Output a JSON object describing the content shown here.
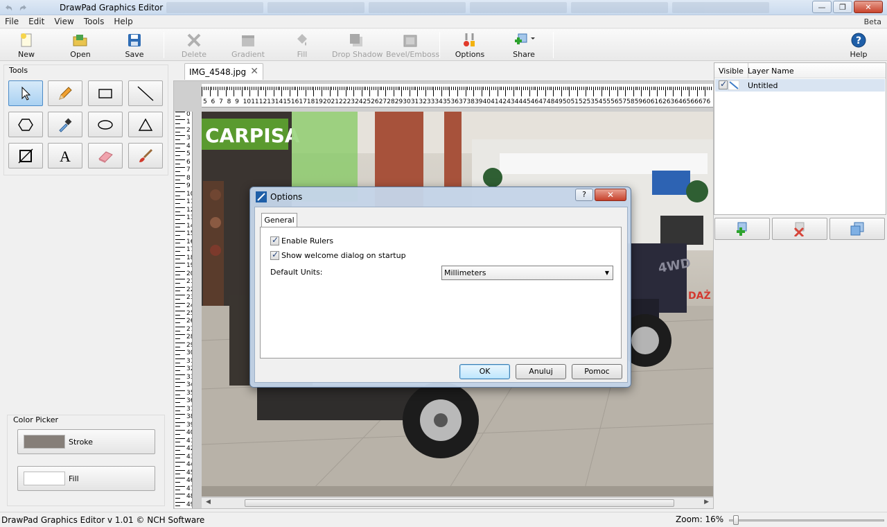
{
  "window": {
    "title": "DrawPad Graphics Editor",
    "min": "—",
    "max": "❐",
    "close": "✕"
  },
  "menu": {
    "items": [
      "File",
      "Edit",
      "View",
      "Tools",
      "Help"
    ],
    "beta": "Beta"
  },
  "toolbar": {
    "new": "New",
    "open": "Open",
    "save": "Save",
    "delete": "Delete",
    "gradient": "Gradient",
    "fill": "Fill",
    "drop_shadow": "Drop Shadow",
    "bevel_emboss": "Bevel/Emboss",
    "options": "Options",
    "share": "Share",
    "help": "Help"
  },
  "tools": {
    "label": "Tools"
  },
  "color_picker": {
    "label": "Color Picker",
    "stroke_label": "Stroke",
    "stroke_color": "#867f79",
    "fill_label": "Fill",
    "fill_color": "#ffffff"
  },
  "document": {
    "tab_name": "IMG_4548.jpg",
    "tab_close": "✕"
  },
  "rulers": {
    "horizontal": [
      "5",
      "6",
      "7",
      "8",
      "9",
      "10",
      "11",
      "12",
      "13",
      "14",
      "15",
      "16",
      "17",
      "18",
      "19",
      "20",
      "21",
      "22",
      "23",
      "24",
      "25",
      "26",
      "27",
      "28",
      "29",
      "30",
      "31",
      "32",
      "33",
      "34",
      "35",
      "36",
      "37",
      "38",
      "39",
      "40",
      "41",
      "42",
      "43",
      "44",
      "45",
      "46",
      "47",
      "48",
      "49",
      "50",
      "51",
      "52",
      "53",
      "54",
      "55",
      "56",
      "57",
      "58",
      "59",
      "60",
      "61",
      "62",
      "63",
      "64",
      "65",
      "66",
      "67",
      "6"
    ],
    "vertical": [
      "0",
      "1",
      "2",
      "3",
      "4",
      "5",
      "6",
      "7",
      "8",
      "9",
      "10",
      "11",
      "12",
      "13",
      "14",
      "15",
      "16",
      "17",
      "18",
      "19",
      "20",
      "21",
      "22",
      "23",
      "24",
      "25",
      "26",
      "27",
      "28",
      "29",
      "30",
      "31",
      "32",
      "33",
      "34",
      "35",
      "36",
      "37",
      "38",
      "39",
      "40",
      "41",
      "42",
      "43",
      "44",
      "45",
      "46",
      "47",
      "48",
      "49"
    ]
  },
  "photo": {
    "shop_sign": "CARPISA",
    "sale_text": "DAŻ"
  },
  "layers": {
    "col_visible": "Visible",
    "col_name": "Layer Name",
    "rows": [
      {
        "name": "Untitled"
      }
    ]
  },
  "status": {
    "text": "DrawPad Graphics Editor v 1.01 © NCH Software",
    "zoom": "Zoom: 16%"
  },
  "dialog": {
    "title": "Options",
    "help": "?",
    "close": "✕",
    "tab": "General",
    "enable_rulers": "Enable Rulers",
    "show_welcome": "Show welcome dialog on startup",
    "default_units_label": "Default Units:",
    "default_units_value": "Millimeters",
    "ok": "OK",
    "cancel": "Anuluj",
    "help_btn": "Pomoc"
  },
  "colors": {
    "accent": "#4b8ac7",
    "selection": "#d9e4f2"
  }
}
